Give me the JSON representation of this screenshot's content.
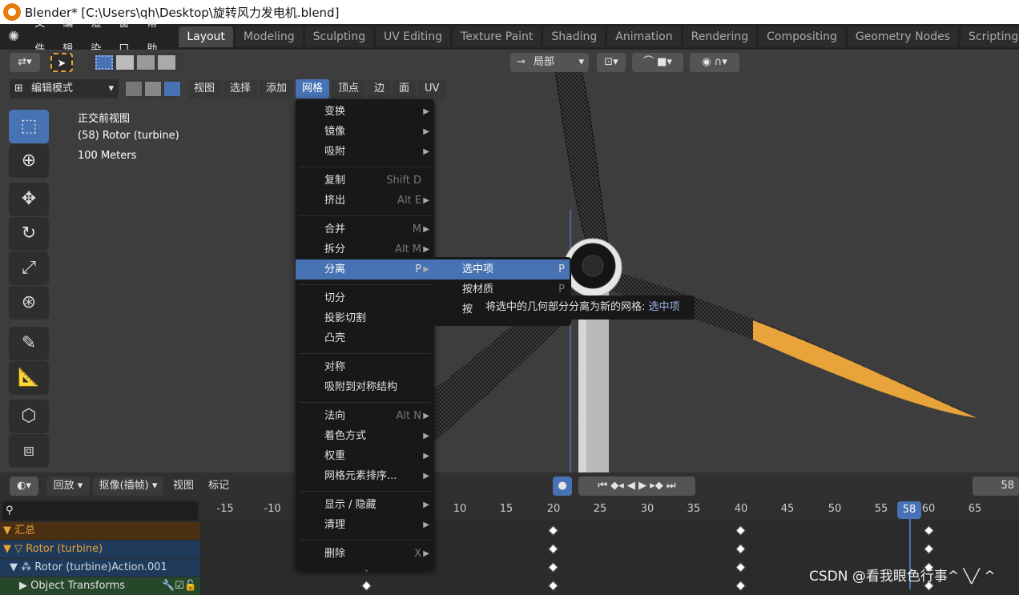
{
  "window": {
    "title": "Blender* [C:\\Users\\qh\\Desktop\\旋转风力发电机.blend]"
  },
  "menubar": {
    "items": [
      "文件",
      "编辑",
      "渲染",
      "窗口",
      "帮助"
    ],
    "tabs": [
      "Layout",
      "Modeling",
      "Sculpting",
      "UV Editing",
      "Texture Paint",
      "Shading",
      "Animation",
      "Rendering",
      "Compositing",
      "Geometry Nodes",
      "Scripting"
    ],
    "active_tab": "Layout"
  },
  "viewport_header": {
    "mode": "编辑模式",
    "menus": [
      "视图",
      "选择",
      "添加",
      "网格",
      "顶点",
      "边",
      "面",
      "UV"
    ],
    "pivot": "局部"
  },
  "overlay": {
    "view_name": "正交前视图",
    "object": "(58) Rotor (turbine)",
    "scale": "100 Meters"
  },
  "mesh_menu": {
    "items": [
      {
        "label": "变换",
        "shortcut": "",
        "submenu": true
      },
      {
        "label": "镜像",
        "shortcut": "",
        "submenu": true
      },
      {
        "label": "吸附",
        "shortcut": "",
        "submenu": true
      },
      {
        "label": "复制",
        "shortcut": "Shift D",
        "submenu": false
      },
      {
        "label": "挤出",
        "shortcut": "Alt E",
        "submenu": true
      },
      {
        "label": "合并",
        "shortcut": "M",
        "submenu": true
      },
      {
        "label": "拆分",
        "shortcut": "Alt M",
        "submenu": true
      },
      {
        "label": "分离",
        "shortcut": "P",
        "submenu": true
      },
      {
        "label": "切分",
        "shortcut": "",
        "submenu": false
      },
      {
        "label": "投影切割",
        "shortcut": "",
        "submenu": false
      },
      {
        "label": "凸壳",
        "shortcut": "",
        "submenu": false
      },
      {
        "label": "对称",
        "shortcut": "",
        "submenu": false
      },
      {
        "label": "吸附到对称结构",
        "shortcut": "",
        "submenu": false
      },
      {
        "label": "法向",
        "shortcut": "Alt N",
        "submenu": true
      },
      {
        "label": "着色方式",
        "shortcut": "",
        "submenu": true
      },
      {
        "label": "权重",
        "shortcut": "",
        "submenu": true
      },
      {
        "label": "网格元素排序...",
        "shortcut": "",
        "submenu": true
      },
      {
        "label": "显示 / 隐藏",
        "shortcut": "",
        "submenu": true
      },
      {
        "label": "清理",
        "shortcut": "",
        "submenu": true
      },
      {
        "label": "删除",
        "shortcut": "X",
        "submenu": true
      }
    ]
  },
  "separate_submenu": {
    "items": [
      {
        "label": "选中项",
        "shortcut": "P"
      },
      {
        "label": "按材质",
        "shortcut": "P"
      },
      {
        "label": "按",
        "shortcut": ""
      }
    ]
  },
  "tooltip": {
    "text": "将选中的几何部分分离为新的网格:",
    "value": "选中项"
  },
  "timeline": {
    "menus": [
      "回放",
      "抠像(插帧)",
      "视图",
      "标记"
    ],
    "current_frame": "58",
    "frame_marker": "58",
    "ticks": [
      "-15",
      "-10",
      "10",
      "15",
      "20",
      "25",
      "30",
      "35",
      "40",
      "45",
      "50",
      "55",
      "60",
      "65"
    ],
    "channels": [
      "汇总",
      "Rotor (turbine)",
      "Rotor (turbine)Action.001",
      "Object Transforms"
    ]
  },
  "watermark": "CSDN @看我眼色行事^ ╲╱ ^",
  "colors": {
    "accent": "#4772b3",
    "selection": "#e8a33a",
    "summary_bg": "#4a2f12",
    "channel_bg": "#1f3a5a"
  }
}
